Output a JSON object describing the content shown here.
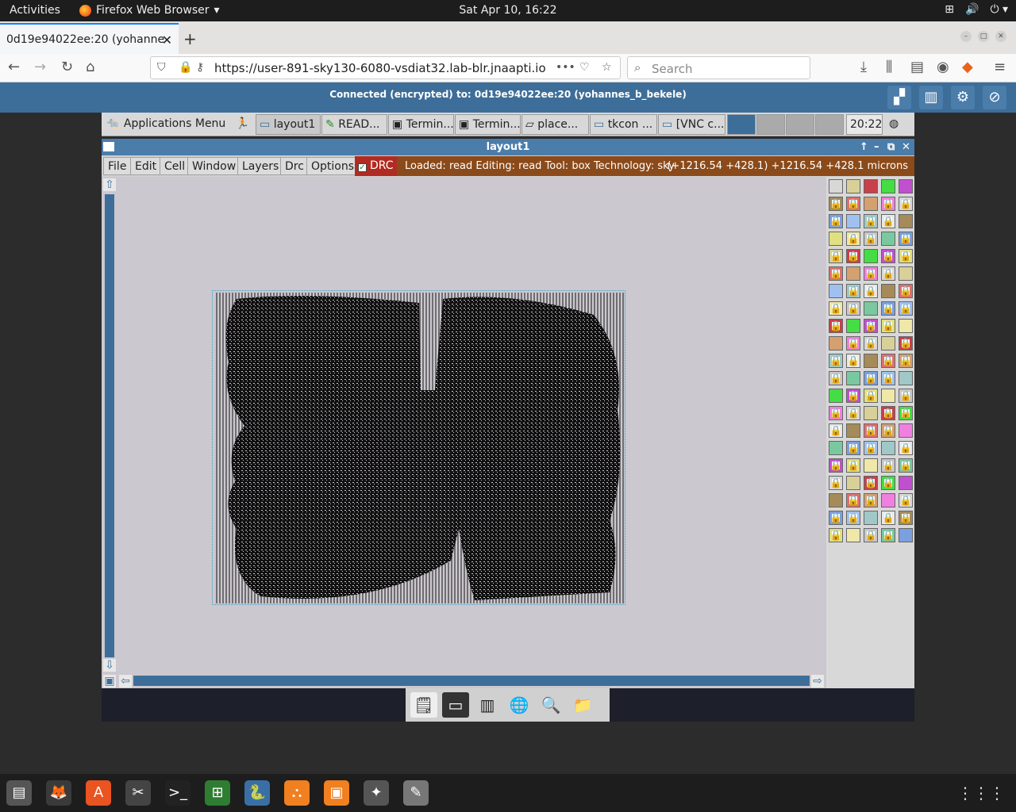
{
  "gnome": {
    "activities": "Activities",
    "app_name": "Firefox Web Browser",
    "clock": "Sat Apr 10, 16:22",
    "tray": [
      "network-icon",
      "volume-icon",
      "power-icon"
    ]
  },
  "browser": {
    "tab_title": "0d19e94022ee:20 (yohanne",
    "url": "https://user-891-sky130-6080-vsdiat32.lab-blr.jnaapti.io",
    "search_placeholder": "Search"
  },
  "vnc": {
    "status": "Connected (encrypted) to: 0d19e94022ee:20 (yohannes_b_bekele)"
  },
  "xpanel": {
    "apps_menu": "Applications Menu",
    "tasks": [
      "layout1",
      "READ...",
      "Termin...",
      "Termin...",
      "place...",
      "tkcon ...",
      "[VNC c..."
    ],
    "clock": "20:22"
  },
  "magic": {
    "window_title": "layout1",
    "menu": [
      "File",
      "Edit",
      "Cell",
      "Window",
      "Layers",
      "Drc",
      "Options"
    ],
    "drc_label": "DRC",
    "status_text": "Loaded: read  Editing: read  Tool: box  Technology: sky",
    "coords_text": "(+1216.54 +428.1) +1216.54 +428.1 microns"
  },
  "colors": {
    "accent": "#3d6e99",
    "status_bg": "#8b4a19",
    "drc_bg": "#b12b22",
    "canvas_bg": "#ccc8cf"
  }
}
